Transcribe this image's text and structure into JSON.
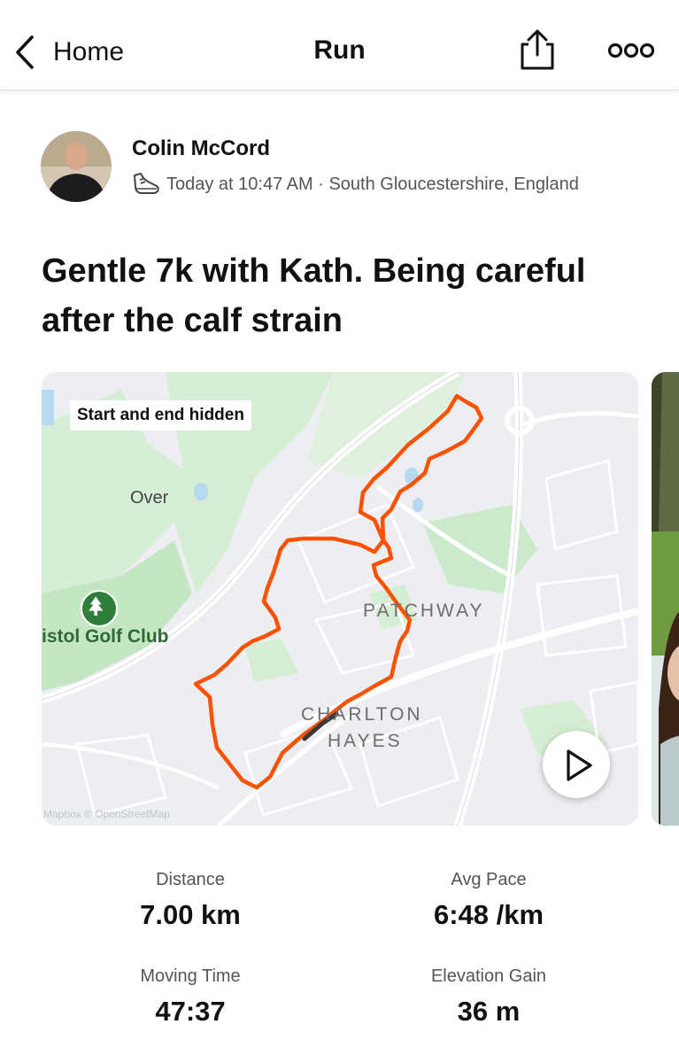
{
  "nav": {
    "back_label": "Home",
    "title": "Run",
    "back_icon": "chevron-left-icon",
    "share_icon": "share-icon",
    "more_icon": "more-horizontal-icon"
  },
  "athlete": {
    "name": "Colin McCord",
    "meta": "Today at 10:47 AM · South Gloucestershire, England",
    "activity_icon": "running-shoe-icon"
  },
  "activity": {
    "title": "Gentle 7k with Kath. Being careful after the calf strain"
  },
  "map": {
    "privacy_badge": "Start and end hidden",
    "labels": {
      "over": "Over",
      "golf_club": "istol Golf Club",
      "patchway": "PATCHWAY",
      "charlton": "CHARLTON",
      "hayes": "HAYES"
    },
    "attribution": "Mapbox © OpenStreetMap",
    "route_color": "#fc5200",
    "play_icon": "play-icon"
  },
  "stats": [
    {
      "label": "Distance",
      "value": "7.00 km"
    },
    {
      "label": "Avg Pace",
      "value": "6:48 /km"
    },
    {
      "label": "Moving Time",
      "value": "47:37"
    },
    {
      "label": "Elevation Gain",
      "value": "36 m"
    }
  ]
}
